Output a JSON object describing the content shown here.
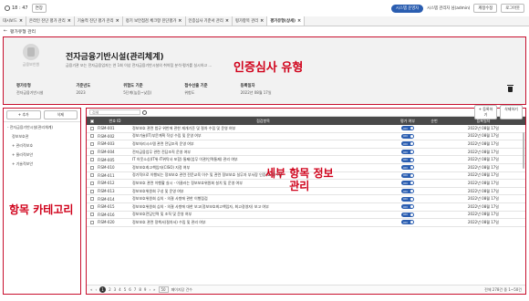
{
  "topbar": {
    "timer": "18 : 47",
    "extend": "연장",
    "badge": "시스템 운영자",
    "user": "시스템 관리자 님(admin)",
    "change_pw": "계정수정",
    "logout": "로그아웃"
  },
  "tabs": [
    {
      "label": "대시보드"
    },
    {
      "label": "온라인 진단 평가 관리"
    },
    {
      "label": "기술적 진단 평가 관리"
    },
    {
      "label": "정기 보안점검 체크항 진단평가"
    },
    {
      "label": "인증심사 기준서 관리"
    },
    {
      "label": "평가항목 관리"
    },
    {
      "label": "평가유형(상세)"
    }
  ],
  "page": {
    "title": "평가유형 관리"
  },
  "info": {
    "logo_text": "금융보안원",
    "cert_name": "전자금융기반시설(관리체계)",
    "cert_desc": "금융기관 또는 전자금융업자는 연 1회 이상 전자금융기반시설의 취약점 분석·평가를 실시하고 ...",
    "type_label": "인증심사 유형",
    "meta": [
      {
        "label": "평가유형",
        "value": "전자금융기반시설"
      },
      {
        "label": "기준년도",
        "value": "2023"
      },
      {
        "label": "위험도 기준",
        "value": "5단계(높음~낮음)"
      },
      {
        "label": "접수선출 기준",
        "value": "위험도"
      },
      {
        "label": "등록일자",
        "value": "2022년 08월 17일"
      }
    ]
  },
  "left": {
    "add": "+ 추가",
    "delete": "삭제",
    "tree": [
      {
        "label": "- 전자금융기반시설(관리체계)",
        "level": 0
      },
      {
        "label": "정보보호관",
        "level": 1
      },
      {
        "label": "+ 관리적보호",
        "level": 1
      },
      {
        "label": "+ 물리적보안",
        "level": 1
      },
      {
        "label": "+ 기술적보안",
        "level": 1
      }
    ],
    "category_label": "항목 카테고리"
  },
  "right": {
    "search_placeholder": "검색",
    "btn_add": "+ 등록하기",
    "btn_delete": "삭제하기",
    "columns": {
      "no": "번호 ID",
      "item": "점검항목",
      "use": "평가 여부",
      "order": "순번",
      "date": "등록일자"
    },
    "rows": [
      {
        "no": "FISM-001",
        "item": "정보보호 관련 법규 위반에 관한 재개기준 및 절차 수립 및 운영 여부",
        "toggle": "ON",
        "date": "2022년 08월 17일"
      },
      {
        "no": "FISM-002",
        "item": "정보기술(IT)부문계획 작성 수립 및 운영 여부",
        "toggle": "ON",
        "date": "2022년 08월 17일"
      },
      {
        "no": "FISM-003",
        "item": "정보처리시스템 관련 전담조직 운영 여부",
        "toggle": "ON",
        "date": "2022년 08월 17일"
      },
      {
        "no": "FISM-004",
        "item": "전자금융업무 관련 전담조직 운영 여부",
        "toggle": "ON",
        "date": "2022년 08월 17일"
      },
      {
        "no": "FISM-005",
        "item": "IT 아웃소싱(IT위·IT위탁사 포함) 통제(업무 이관/인력통제) 관리 여부",
        "toggle": "ON",
        "date": "2022년 08월 17일"
      },
      {
        "no": "FISM-010",
        "item": "정보보호최고책임자(CISO) 지정 여부",
        "toggle": "ON",
        "date": "2022년 08월 17일"
      },
      {
        "no": "FISM-011",
        "item": "정기적으로 이행되는 정보보호 관련 전문교육 이수 및 관련 정보보호 실무자 부서장 인증(교육) 이수",
        "toggle": "ON",
        "date": "2022년 08월 17일"
      },
      {
        "no": "FISM-012",
        "item": "정보보호 관련 이행활 실시 - 이클러는 정보보호위원회 설치 및 운영 여부",
        "toggle": "ON",
        "date": "2022년 08월 17일"
      },
      {
        "no": "FISM-013",
        "item": "정보보호위원회 구성 및 운영 여부",
        "toggle": "ON",
        "date": "2022년 08월 17일"
      },
      {
        "no": "FISM-014",
        "item": "정보보호위원회 심의 - 의결 사항에 관한 이행점검",
        "toggle": "ON",
        "date": "2022년 08월 17일"
      },
      {
        "no": "FISM-015",
        "item": "정보보호위원회 심의 - 의결 사항에 대한 보고(정보보호최고책임자, 최고경영자) 보고 여부",
        "toggle": "ON",
        "date": "2022년 08월 17일"
      },
      {
        "no": "FISM-016",
        "item": "정보보호전담인력 및 조직 및 운영 여부",
        "toggle": "ON",
        "date": "2022년 08월 17일"
      },
      {
        "no": "FISM-020",
        "item": "정보보호 관련 정책서(절차서) 수립 및 관리 여부",
        "toggle": "ON",
        "date": "2022년 08월 17일"
      }
    ],
    "pager": {
      "pages": [
        "1",
        "2",
        "3",
        "4",
        "5",
        "6",
        "7",
        "8",
        "9"
      ],
      "size": "50",
      "size_label": "페이지당 건수",
      "total": "전체 278건 중 1~50건"
    },
    "detail_label_line1": "세부 항목 정보",
    "detail_label_line2": "관리"
  }
}
